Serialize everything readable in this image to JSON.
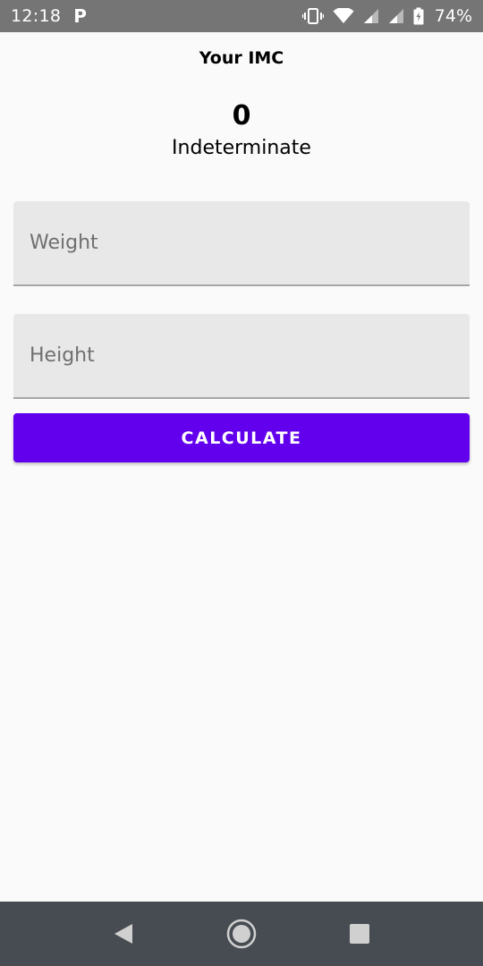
{
  "status_bar": {
    "time": "12:18",
    "battery": "74%",
    "icons": [
      "parking-icon",
      "vibrate-icon",
      "wifi-icon",
      "signal-icon",
      "signal-icon-2",
      "battery-icon"
    ]
  },
  "result": {
    "title": "Your IMC",
    "value": "0",
    "status": "Indeterminate"
  },
  "form": {
    "weight_placeholder": "Weight",
    "weight_value": "",
    "height_placeholder": "Height",
    "height_value": "",
    "calculate_label": "CALCULATE"
  },
  "colors": {
    "accent": "#6200ee",
    "status_bar": "#757575",
    "nav_bar": "#474c52",
    "field_bg": "#e8e8e8"
  },
  "nav_bar": {
    "icons": [
      "back-icon",
      "home-icon",
      "recents-icon"
    ]
  }
}
